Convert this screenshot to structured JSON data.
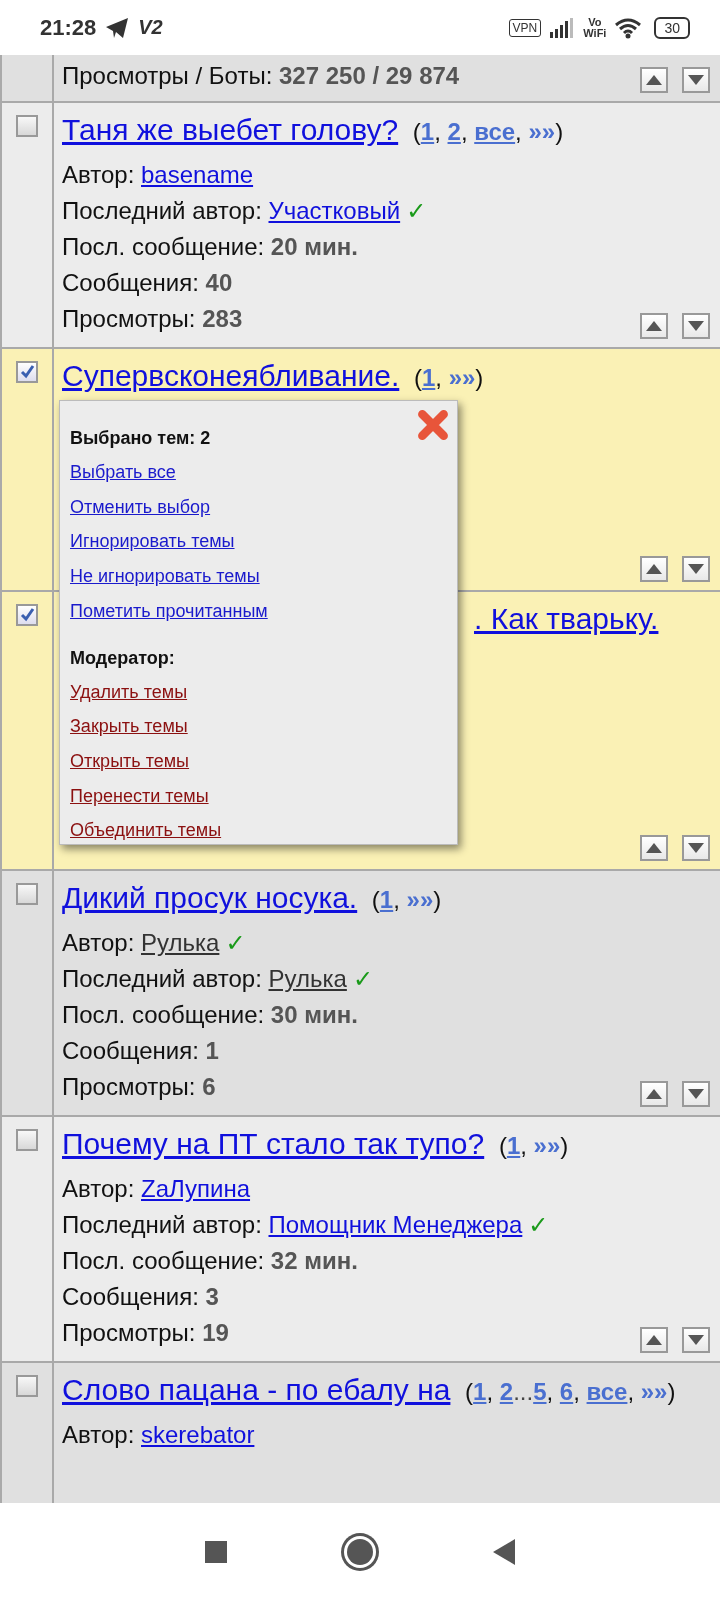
{
  "status_bar": {
    "time": "21:28",
    "carrier_tag": "V2",
    "vpn": "VPN",
    "vowifi_top": "Vo",
    "vowifi_bottom": "WiFi",
    "battery": "30"
  },
  "top_row": {
    "label": "Просмотры / Боты:",
    "value": "327 250 / 29 874"
  },
  "topics": [
    {
      "checked": false,
      "title_partial": false,
      "title": "Таня же выебет голову?",
      "pages": {
        "open": "(",
        "close": ")",
        "items": [
          {
            "kind": "num",
            "label": "1",
            "sep": ","
          },
          {
            "kind": "num",
            "label": "2",
            "sep": ","
          },
          {
            "kind": "all",
            "label": "все",
            "sep": ","
          },
          {
            "kind": "next",
            "label": "»»"
          }
        ]
      },
      "meta": [
        {
          "kind": "user_link",
          "label": "Автор:",
          "value": "basename"
        },
        {
          "kind": "user_link",
          "label": "Последний автор:",
          "value": "Участковый",
          "check": "✓"
        },
        {
          "kind": "stat",
          "label": "Посл. сообщение:",
          "value": "20 мин."
        },
        {
          "kind": "stat",
          "label": "Сообщения:",
          "value": "40"
        },
        {
          "kind": "stat",
          "label": "Просмотры:",
          "value": "283"
        }
      ]
    },
    {
      "checked": true,
      "title_partial": false,
      "title": "Супервсконеябливание.",
      "pages": {
        "open": "(",
        "close": ")",
        "items": [
          {
            "kind": "num",
            "label": "1",
            "sep": ","
          },
          {
            "kind": "next",
            "label": "»»"
          }
        ]
      }
    },
    {
      "checked": true,
      "title_partial": true,
      "title": ". Как тварьку."
    },
    {
      "checked": false,
      "title_partial": false,
      "title": "Дикий просук носука.",
      "pages": {
        "open": "(",
        "close": ")",
        "items": [
          {
            "kind": "num",
            "label": "1",
            "sep": ","
          },
          {
            "kind": "next",
            "label": "»»"
          }
        ]
      },
      "meta": [
        {
          "kind": "user_plain",
          "label": "Автор:",
          "value": "Рулька",
          "check": "✓"
        },
        {
          "kind": "user_plain",
          "label": "Последний автор:",
          "value": "Рулька",
          "check": "✓"
        },
        {
          "kind": "stat",
          "label": "Посл. сообщение:",
          "value": "30 мин."
        },
        {
          "kind": "stat",
          "label": "Сообщения:",
          "value": "1"
        },
        {
          "kind": "stat",
          "label": "Просмотры:",
          "value": "6"
        }
      ]
    },
    {
      "checked": false,
      "title_partial": false,
      "title": "Почему на ПТ стало так тупо?",
      "pages": {
        "open": "(",
        "close": ")",
        "items": [
          {
            "kind": "num",
            "label": "1",
            "sep": ","
          },
          {
            "kind": "next",
            "label": "»»"
          }
        ]
      },
      "meta": [
        {
          "kind": "user_link",
          "label": "Автор:",
          "value": "ZaЛупина"
        },
        {
          "kind": "user_link",
          "label": "Последний автор:",
          "value": "Помощник Менеджера",
          "check": "✓"
        },
        {
          "kind": "stat",
          "label": "Посл. сообщение:",
          "value": "32 мин."
        },
        {
          "kind": "stat",
          "label": "Сообщения:",
          "value": "3"
        },
        {
          "kind": "stat",
          "label": "Просмотры:",
          "value": "19"
        }
      ]
    },
    {
      "checked": false,
      "title_partial": false,
      "title": "Слово пацана - по ебалу на",
      "pages": {
        "open": "(",
        "close": ")",
        "items": [
          {
            "kind": "num",
            "label": "1",
            "sep": ","
          },
          {
            "kind": "num",
            "label": "2"
          },
          {
            "kind": "ellipsis",
            "label": "..."
          },
          {
            "kind": "num",
            "label": "5",
            "sep": ","
          },
          {
            "kind": "num",
            "label": "6",
            "sep": ","
          },
          {
            "kind": "all",
            "label": "все",
            "sep": ","
          },
          {
            "kind": "next",
            "label": "»»"
          }
        ]
      },
      "meta": [
        {
          "kind": "user_link",
          "label": "Автор:",
          "value": "skerebator"
        }
      ]
    }
  ],
  "popup": {
    "items": [
      {
        "kind": "heading",
        "label": "Выбрано тем: 2"
      },
      {
        "kind": "link",
        "label": "Выбрать все"
      },
      {
        "kind": "link",
        "label": "Отменить выбор"
      },
      {
        "kind": "link",
        "label": "Игнорировать темы"
      },
      {
        "kind": "link",
        "label": "Не игнорировать темы"
      },
      {
        "kind": "link",
        "label": "Пометить прочитанным"
      },
      {
        "kind": "heading",
        "label": "Модератор:"
      },
      {
        "kind": "mod_link",
        "label": "Удалить темы"
      },
      {
        "kind": "mod_link",
        "label": "Закрыть темы"
      },
      {
        "kind": "mod_link",
        "label": "Открыть темы"
      },
      {
        "kind": "mod_link",
        "label": "Перенести темы"
      },
      {
        "kind": "mod_link",
        "label": "Объединить темы"
      }
    ]
  }
}
